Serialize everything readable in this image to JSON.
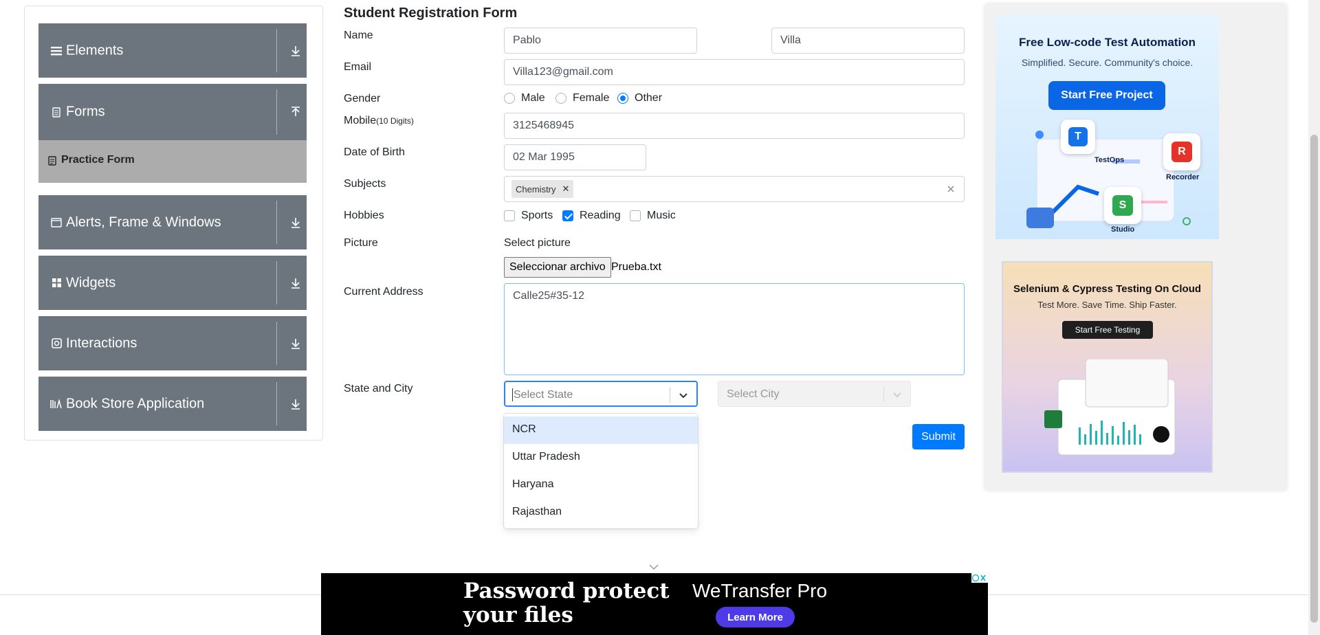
{
  "sidebar": {
    "groups": [
      {
        "label": "Elements"
      },
      {
        "label": "Forms"
      },
      {
        "label": "Alerts, Frame & Windows"
      },
      {
        "label": "Widgets"
      },
      {
        "label": "Interactions"
      },
      {
        "label": "Book Store Application"
      }
    ],
    "active_item": {
      "label": "Practice Form"
    }
  },
  "form": {
    "title": "Student Registration Form",
    "labels": {
      "name": "Name",
      "email": "Email",
      "gender": "Gender",
      "mobile": "Mobile",
      "mobile_hint": "(10 Digits)",
      "dob": "Date of Birth",
      "subjects": "Subjects",
      "hobbies": "Hobbies",
      "picture": "Picture",
      "address": "Current Address",
      "state_city": "State and City"
    },
    "first_name": "Pablo",
    "last_name": "Villa",
    "email": "Villa123@gmail.com",
    "gender_options": [
      "Male",
      "Female",
      "Other"
    ],
    "gender_selected": "Other",
    "mobile": "3125468945",
    "dob": "02 Mar 1995",
    "subjects": [
      "Chemistry"
    ],
    "hobbies": [
      {
        "label": "Sports",
        "checked": false
      },
      {
        "label": "Reading",
        "checked": true
      },
      {
        "label": "Music",
        "checked": false
      }
    ],
    "picture_caption": "Select picture",
    "file_button": "Seleccionar archivo",
    "file_name": "Prueba.txt",
    "address": "Calle25#35-12",
    "state_placeholder": "Select State",
    "city_placeholder": "Select City",
    "state_options": [
      "NCR",
      "Uttar Pradesh",
      "Haryana",
      "Rajasthan"
    ],
    "submit": "Submit"
  },
  "ads": {
    "ad1": {
      "title": "Free Low-code Test Automation",
      "subtitle": "Simplified. Secure. Community's choice.",
      "cta": "Start Free Project",
      "labels": [
        "TestOps",
        "Recorder",
        "Studio"
      ]
    },
    "ad2": {
      "title": "Selenium & Cypress Testing On Cloud",
      "subtitle": "Test More. Save Time. Ship Faster.",
      "cta": "Start Free Testing"
    }
  },
  "banner": {
    "headline_1": "Password protect",
    "headline_2": "your files",
    "brand": "WeTransfer Pro",
    "cta": "Learn More"
  },
  "colors": {
    "primary": "#007bff",
    "sidebar_group": "#6c757d",
    "sidebar_active": "#acacac"
  }
}
